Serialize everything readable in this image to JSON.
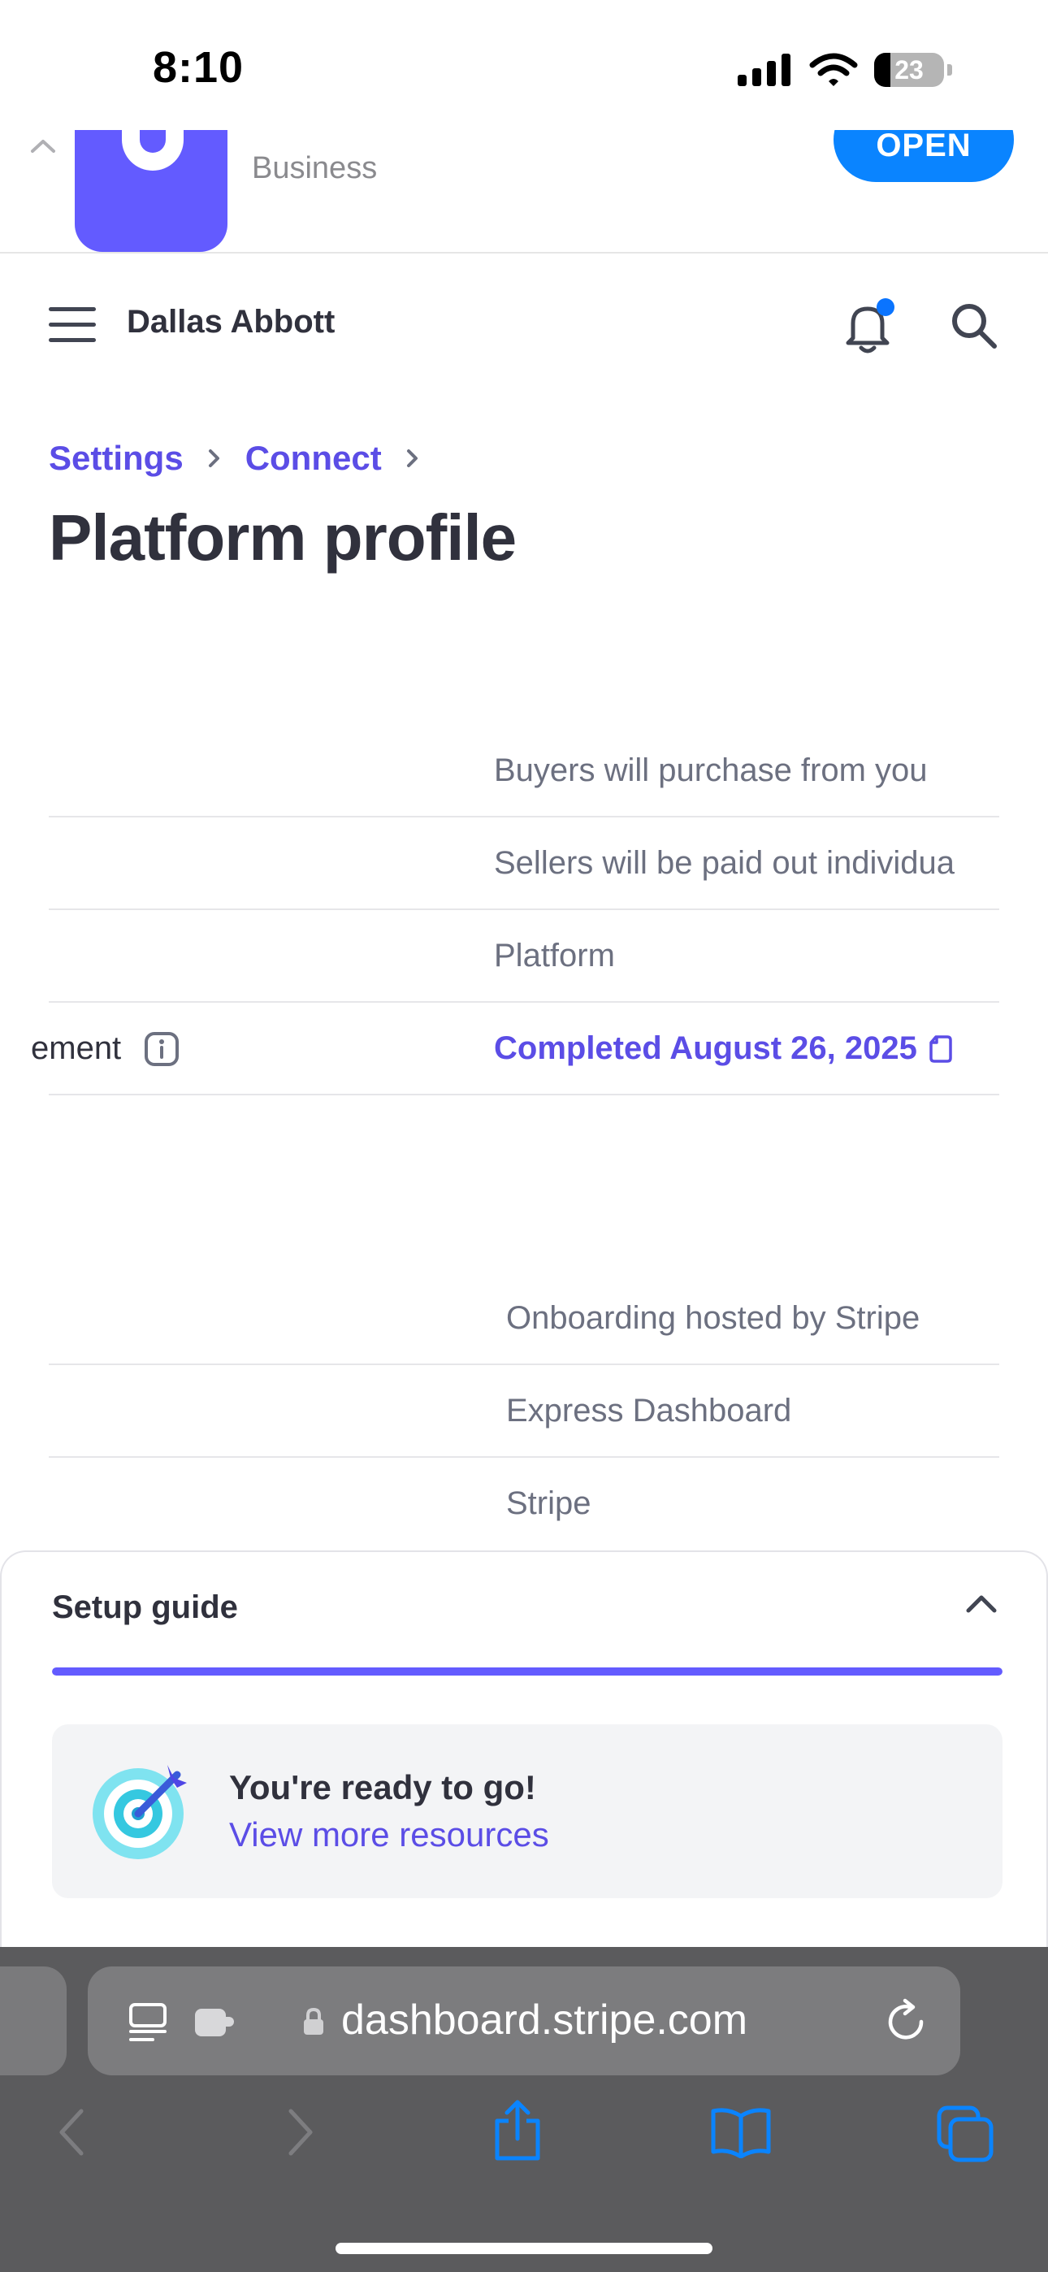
{
  "status_bar": {
    "time": "8:10",
    "battery_level": "23",
    "icons": [
      "cellular-signal-icon",
      "wifi-icon",
      "battery-icon"
    ]
  },
  "app_banner": {
    "subtitle": "Business",
    "open_label": "OPEN",
    "icon": "stripe-app-icon"
  },
  "header": {
    "account_name": "Dallas Abbott",
    "icons": [
      "menu-icon",
      "bell-icon",
      "search-icon"
    ],
    "notification_dot_color": "#0a74ff"
  },
  "breadcrumb": {
    "items": [
      "Settings",
      "Connect"
    ]
  },
  "page": {
    "title": "Platform profile"
  },
  "profile_details": [
    {
      "label": "",
      "value": "Buyers will purchase from you"
    },
    {
      "label": "",
      "value": "Sellers will be paid out individua"
    },
    {
      "label": "",
      "value": "Platform"
    },
    {
      "label": "ement",
      "value": "Completed August 26, 2025",
      "value_is_link": true
    }
  ],
  "onboarding_details": [
    {
      "label": "",
      "value": "Onboarding hosted by Stripe"
    },
    {
      "label": "",
      "value": "Express Dashboard"
    },
    {
      "label": "",
      "value": "Stripe"
    }
  ],
  "setup_guide": {
    "title": "Setup guide",
    "progress_percent": 100,
    "ready_text": "You're ready to go!",
    "resources_link": "View more resources"
  },
  "safari": {
    "url": "dashboard.stripe.com",
    "toolbar_icons": [
      "back-icon",
      "forward-icon",
      "share-icon",
      "bookmarks-icon",
      "tabs-icon"
    ]
  },
  "colors": {
    "accent": "#635bff",
    "link": "#5b4de6",
    "text": "#30313d",
    "muted": "#6c7080",
    "ios_blue": "#0a84ff"
  }
}
